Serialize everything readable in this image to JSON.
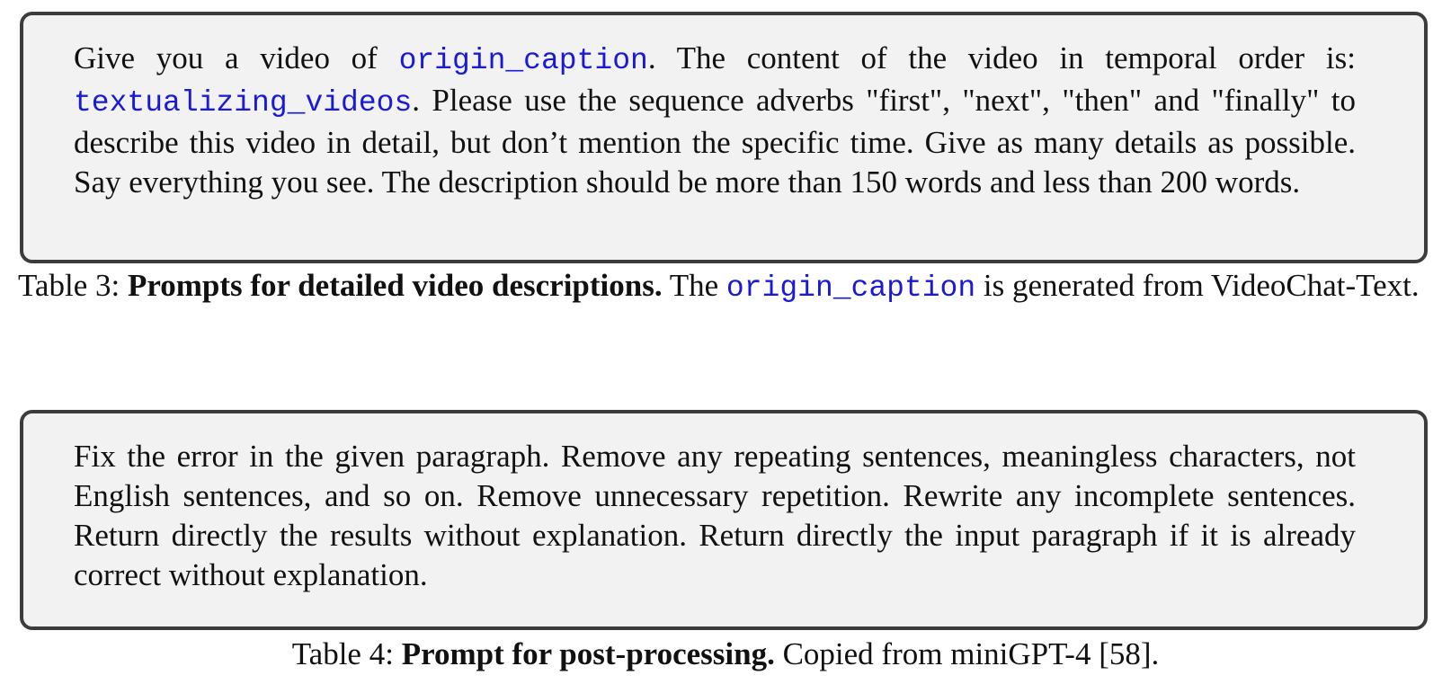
{
  "prompt_boxes": [
    {
      "segments": [
        {
          "text": "Give you a video of ",
          "style": "normal"
        },
        {
          "text": "origin_caption",
          "style": "code"
        },
        {
          "text": ". The content of the video in temporal order is: ",
          "style": "normal"
        },
        {
          "text": "textualizing_videos",
          "style": "code"
        },
        {
          "text": ". Please use the sequence adverbs \"first\", \"next\", \"then\" and \"finally\" to describe this video in detail, but don’t mention the specific time. Give as many details as possible. Say everything you see. The description should be more than 150 words and less than 200 words.",
          "style": "normal"
        }
      ]
    },
    {
      "segments": [
        {
          "text": "Fix the error in the given paragraph. Remove any repeating sentences, meaningless char­acters, not English sentences, and so on. Remove unnecessary repetition. Rewrite any incomplete sentences. Return directly the results without explanation. Return directly the input paragraph if it is already correct without explanation.",
          "style": "normal"
        }
      ]
    }
  ],
  "captions": [
    {
      "label": "Table 3: ",
      "bold": "Prompts for detailed video descriptions.",
      "text_before_code": " The ",
      "code": "origin_caption",
      "text_after_code": " is generated from VideoChat-Text."
    },
    {
      "label": "Table 4: ",
      "bold": "Prompt for post-processing.",
      "text": " Copied from miniGPT-4 [58]."
    }
  ],
  "colors": {
    "code_text": "#1a1ad6",
    "box_background": "#f2f2f2",
    "box_border": "#3c3c3c"
  }
}
